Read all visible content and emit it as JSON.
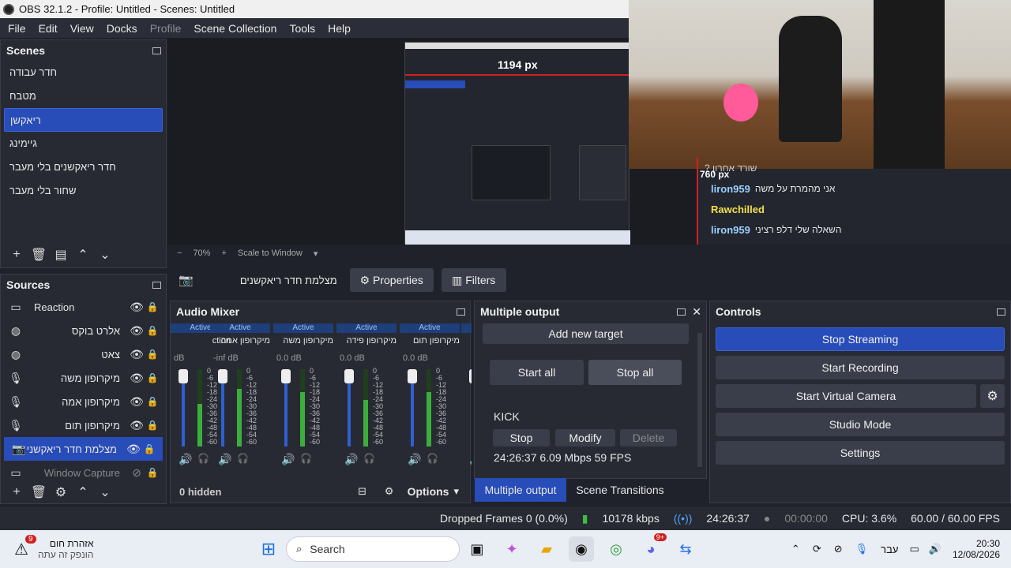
{
  "window": {
    "title": "OBS 32.1.2 - Profile: Untitled - Scenes: Untitled"
  },
  "menu": [
    "File",
    "Edit",
    "View",
    "Docks",
    "Profile",
    "Scene Collection",
    "Tools",
    "Help"
  ],
  "scenes": {
    "title": "Scenes",
    "items": [
      "חדר עבודה",
      "מטבח",
      "ריאקשן",
      "גיימינג",
      "חדר ריאקשנים בלי מעבר",
      "שחור בלי מעבר"
    ],
    "selected": 2
  },
  "sources": {
    "title": "Sources",
    "items": [
      {
        "name": "Reaction",
        "icon": "group-icon"
      },
      {
        "name": "אלרט בוקס",
        "icon": "globe-icon"
      },
      {
        "name": "צאט",
        "icon": "globe-icon"
      },
      {
        "name": "מיקרופון משה",
        "icon": "mic-icon"
      },
      {
        "name": "מיקרופון אמה",
        "icon": "mic-icon"
      },
      {
        "name": "מיקרופון תום",
        "icon": "mic-icon"
      },
      {
        "name": "מצלמת חדר ריאקשני",
        "icon": "camera-icon"
      },
      {
        "name": "Window Capture",
        "icon": "window-icon"
      }
    ]
  },
  "preview": {
    "measure_w": "1194 px",
    "measure_h": "760 px",
    "chat": [
      {
        "user": "liron959",
        "msg": "אני מהמרת על משה"
      },
      {
        "user": "Rawchilled",
        "msg": ""
      },
      {
        "user": "liron959",
        "msg": "השאלה שלי דלפ רציני"
      }
    ],
    "chat_top": "? שורד אחרון"
  },
  "zoom": {
    "level": "70%",
    "scale": "Scale to Window"
  },
  "sourcebar": {
    "name": "מצלמת חדר ריאקשנים",
    "properties": "Properties",
    "filters": "Filters"
  },
  "mixer": {
    "title": "Audio Mixer",
    "hidden": "0 hidden",
    "options": "Options",
    "channels": [
      {
        "name": "ction",
        "status": "Active",
        "db": "dB"
      },
      {
        "name": "מיקרופון אמה",
        "status": "Active",
        "db": "-inf dB"
      },
      {
        "name": "מיקרופון משה",
        "status": "Active",
        "db": "0.0 dB"
      },
      {
        "name": "מיקרופון פידה",
        "status": "Active",
        "db": "0.0 dB"
      },
      {
        "name": "מיקרופון תום",
        "status": "Active",
        "db": "0.0 dB"
      },
      {
        "name": "בה",
        "status": "",
        "db": ""
      }
    ],
    "scale": [
      "0",
      "-6",
      "-12",
      "-18",
      "-24",
      "-30",
      "-36",
      "-42",
      "-48",
      "-54",
      "-60"
    ]
  },
  "multiout": {
    "title": "Multiple output",
    "add": "Add new target",
    "start_all": "Start all",
    "stop_all": "Stop all",
    "target": "KICK",
    "stop": "Stop",
    "modify": "Modify",
    "delete": "Delete",
    "stats": "24:26:37  6.09 Mbps  59 FPS",
    "tab1": "Multiple output",
    "tab2": "Scene Transitions"
  },
  "controls": {
    "title": "Controls",
    "buttons": [
      "Stop Streaming",
      "Start Recording",
      "Start Virtual Camera",
      "Studio Mode",
      "Settings"
    ]
  },
  "status": {
    "dropped": "Dropped Frames 0 (0.0%)",
    "kbps": "10178 kbps",
    "live": "24:26:37",
    "rec": "00:00:00",
    "cpu": "CPU: 3.6%",
    "fps": "60.00 / 60.00 FPS"
  },
  "taskbar": {
    "weather_title": "אזהרת חום",
    "weather_sub": "הונפק זה עתה",
    "weather_badge": "9",
    "search": "Search",
    "lang": "עבר",
    "time": "20:30",
    "date": "12/08/2026",
    "discord_badge": "9+"
  },
  "colors": {
    "accent": "#284cb8",
    "panel": "#272a33",
    "bg": "#1f222a"
  }
}
